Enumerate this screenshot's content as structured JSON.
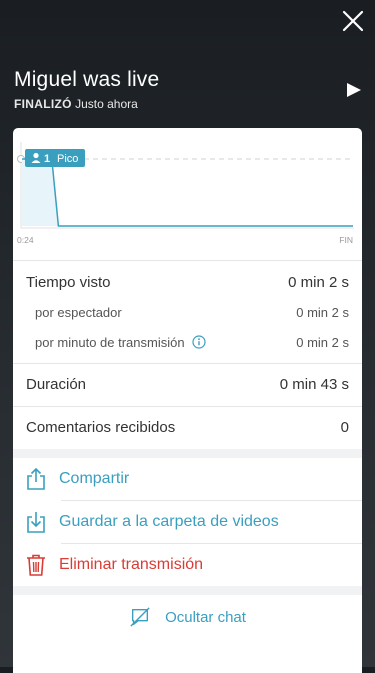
{
  "header": {
    "title": "Miguel was live",
    "status": "FINALIZÓ",
    "time": "Justo ahora"
  },
  "chart": {
    "badge_count": "1",
    "badge_label": "Pico",
    "x_start": "0:24",
    "x_end": "FIN"
  },
  "chart_data": {
    "type": "area",
    "x": [
      0,
      0.04,
      0.09,
      0.11,
      1.0
    ],
    "y": [
      1,
      1,
      1,
      0,
      0
    ],
    "ylim": [
      0,
      1
    ],
    "xlabel": "",
    "ylabel": ""
  },
  "stats": {
    "watch_time_label": "Tiempo visto",
    "watch_time_value": "0 min 2 s",
    "per_viewer_label": "por espectador",
    "per_viewer_value": "0 min 2 s",
    "per_minute_label": "por minuto de transmisión",
    "per_minute_value": "0 min 2 s",
    "duration_label": "Duración",
    "duration_value": "0 min 43 s",
    "comments_label": "Comentarios recibidos",
    "comments_value": "0"
  },
  "actions": {
    "share": "Compartir",
    "save": "Guardar a la carpeta de videos",
    "delete": "Eliminar transmisión",
    "hide_chat": "Ocultar chat"
  },
  "colors": {
    "accent": "#3a9fbf",
    "danger": "#d83c35"
  }
}
